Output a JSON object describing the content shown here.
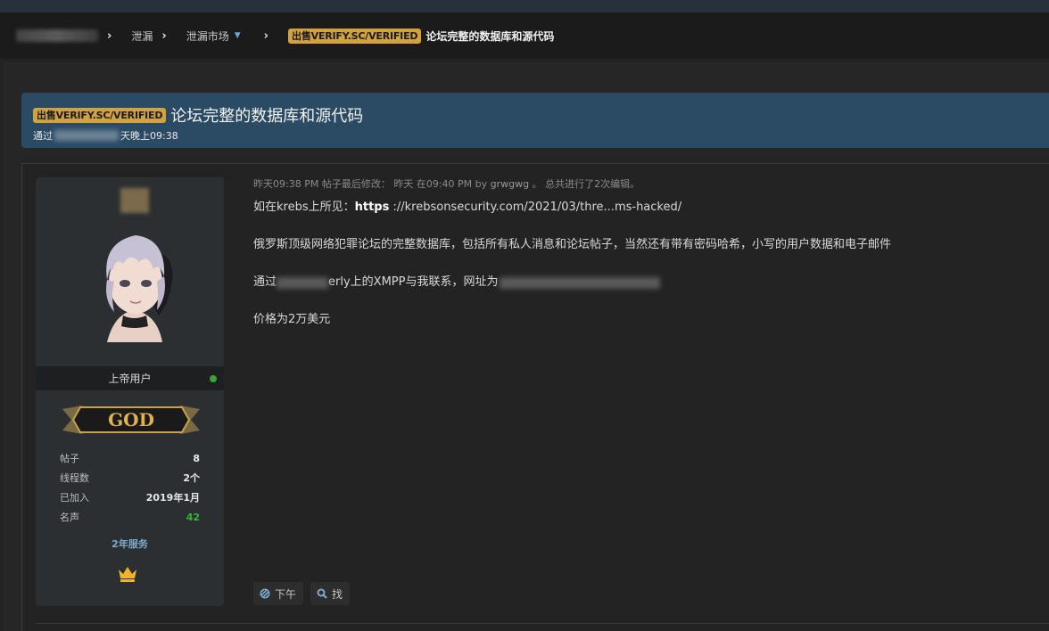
{
  "breadcrumb": {
    "items": [
      "泄漏",
      "泄漏市场"
    ],
    "separator": "›",
    "badge": "出售VERIFY.SC/VERIFIED",
    "current": "论坛完整的数据库和源代码"
  },
  "thread": {
    "badge": "出售VERIFY.SC/VERIFIED",
    "title": "论坛完整的数据库和源代码",
    "sub_prefix": "通过",
    "sub_suffix": "天晚上09:38"
  },
  "user": {
    "rank": "上帝用户",
    "god_label": "GOD",
    "stats": [
      {
        "label": "帖子",
        "value": "8"
      },
      {
        "label": "线程数",
        "value": "2个"
      },
      {
        "label": "已加入",
        "value": "2019年1月"
      },
      {
        "label": "名声",
        "value": "42"
      }
    ],
    "service": "2年服务"
  },
  "post": {
    "meta_time": "昨天09:38 PM",
    "meta_edit": "帖子最后修改：  昨天 在09:40 PM by",
    "meta_editor": "grwgwg",
    "meta_tail": "。  总共进行了2次编辑。",
    "line1_prefix": "如在krebs上所见：",
    "line1_strong": "https",
    "line1_rest": " ://krebsonsecurity.com/2021/03/thre...ms-hacked/",
    "line2": "俄罗斯顶级网络犯罪论坛的完整数据库，包括所有私人消息和论坛帖子，当然还有带有密码哈希，小写的用户数据和电子邮件",
    "line3_prefix": "通过",
    "line3_mid": "erly上的XMPP与我联系，网址为",
    "line4": "价格为2万美元"
  },
  "buttons": {
    "pm_label": "下午",
    "find_label": "找"
  },
  "colors": {
    "badge": "#d2a23c",
    "title_panel": "#2b4a64",
    "online": "#3aa33a",
    "reputation": "#38b338"
  }
}
